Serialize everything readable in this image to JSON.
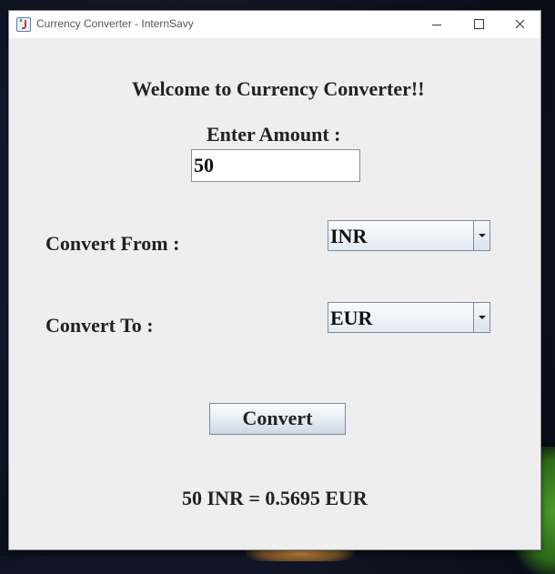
{
  "window": {
    "title": "Currency Converter - InternSavy",
    "controls": [
      "minimize-icon",
      "maximize-icon",
      "close-icon"
    ]
  },
  "form": {
    "welcome": "Welcome to Currency Converter!!",
    "amount_label": "Enter Amount :",
    "amount_value": "50",
    "from_label": "Convert From :",
    "from_value": "INR",
    "to_label": "Convert To :",
    "to_value": "EUR",
    "convert_label": "Convert",
    "result": "50 INR = 0.5695 EUR"
  }
}
